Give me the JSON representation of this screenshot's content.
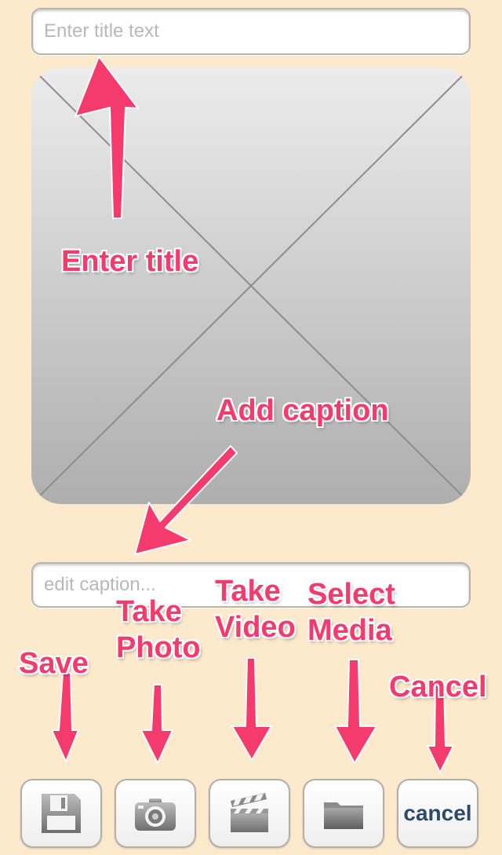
{
  "form": {
    "title_placeholder": "Enter title text",
    "caption_placeholder": "edit caption..."
  },
  "annotations": {
    "enter_title": "Enter title",
    "add_caption": "Add caption",
    "save": "Save",
    "take_photo": "Take\nPhoto",
    "take_video": "Take\nVideo",
    "select_media": "Select\nMedia",
    "cancel": "Cancel"
  },
  "toolbar": {
    "cancel_label": "cancel",
    "buttons": [
      {
        "name": "save",
        "icon": "floppy-disk-icon"
      },
      {
        "name": "take-photo",
        "icon": "camera-icon"
      },
      {
        "name": "take-video",
        "icon": "clapperboard-icon"
      },
      {
        "name": "select-media",
        "icon": "folder-icon"
      },
      {
        "name": "cancel",
        "icon": null
      }
    ]
  },
  "colors": {
    "background": "#fde9cb",
    "annotation": "#f53a6e",
    "cancel_text": "#2d4a6a"
  }
}
